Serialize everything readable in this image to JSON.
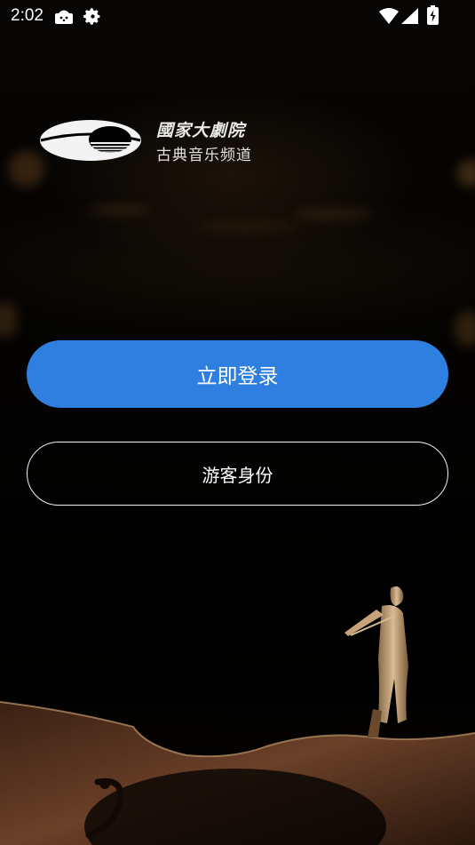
{
  "status_bar": {
    "time": "2:02",
    "icons": [
      "android-debug-icon",
      "settings-gear-icon",
      "wifi-icon",
      "cell-signal-icon",
      "battery-charging-icon"
    ]
  },
  "logo": {
    "title": "國家大劇院",
    "subtitle": "古典音乐频道"
  },
  "actions": {
    "login_label": "立即登录",
    "guest_label": "游客身份"
  },
  "colors": {
    "primary_button": "#2f7fe0",
    "background": "#000000",
    "outline": "#f2f2f2"
  }
}
